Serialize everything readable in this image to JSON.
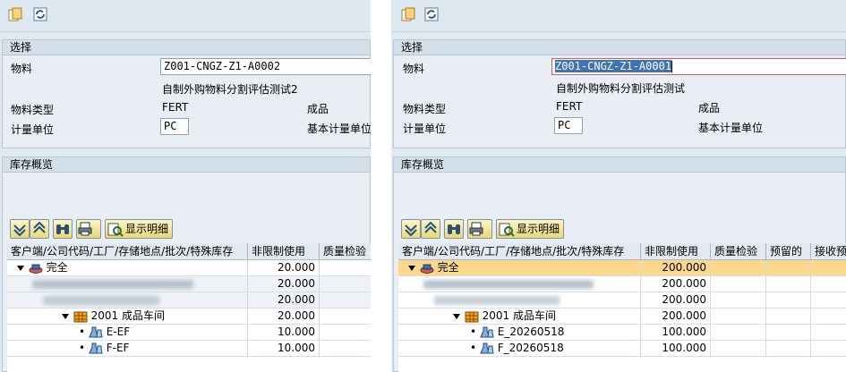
{
  "left": {
    "section_title": "选择",
    "material_label": "物料",
    "material_value": "Z001-CNGZ-Z1-A0002",
    "material_desc": "自制外购物料分割评估测试2",
    "material_type_label": "物料类型",
    "material_type_value": "FERT",
    "material_type_desc": "成品",
    "uom_label": "计量单位",
    "uom_value": "PC",
    "base_uom_label": "基本计量单位",
    "overview_title": "库存概览",
    "detail_label": "显示明细",
    "columns": [
      "客户端/公司代码/工厂/存储地点/批次/特殊库存",
      "非限制使用",
      "质量检验"
    ],
    "rows": [
      {
        "label": "完全",
        "qty": "20.000"
      },
      {
        "label": "",
        "qty": "20.000"
      },
      {
        "label": "",
        "qty": "20.000"
      },
      {
        "label": "2001 成品车间",
        "qty": "20.000"
      },
      {
        "label": "E-EF",
        "qty": "10.000"
      },
      {
        "label": "F-EF",
        "qty": "10.000"
      }
    ]
  },
  "right": {
    "section_title": "选择",
    "material_label": "物料",
    "material_value": "Z001-CNGZ-Z1-A0001",
    "material_desc": "自制外购物料分割评估测试",
    "material_type_label": "物料类型",
    "material_type_value": "FERT",
    "material_type_desc": "成品",
    "uom_label": "计量单位",
    "uom_value": "PC",
    "base_uom_label": "基本计量单位",
    "overview_title": "库存概览",
    "detail_label": "显示明细",
    "columns": [
      "客户端/公司代码/工厂/存储地点/批次/特殊库存",
      "非限制使用",
      "质量检验",
      "预留的",
      "接收预"
    ],
    "rows": [
      {
        "label": "完全",
        "qty": "200.000"
      },
      {
        "label": "",
        "qty": "200.000"
      },
      {
        "label": "",
        "qty": "200.000"
      },
      {
        "label": "2001 成品车间",
        "qty": "200.000"
      },
      {
        "label": "E_20260518",
        "qty": "100.000"
      },
      {
        "label": "F_20260518",
        "qty": "100.000"
      }
    ]
  },
  "icons": [
    "new-session-icon",
    "refresh-icon",
    "expand-all-icon",
    "collapse-all-icon",
    "binoculars-icon",
    "print-icon",
    "detail-icon",
    "expand-node-icon",
    "plant-icon",
    "batch-icon",
    "client-icon"
  ],
  "colors": {
    "panel": "#dfe9f1",
    "header": "#d3dfe9",
    "highlight_row": "#fbd88c",
    "selection": "#3f74b3"
  }
}
